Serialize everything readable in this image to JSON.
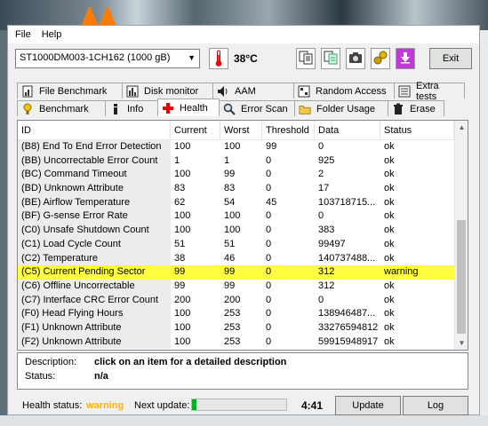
{
  "menu": [
    "File",
    "Help"
  ],
  "toolbar": {
    "drive": "ST1000DM003-1CH162 (1000 gB)",
    "temperature": "38°C",
    "exit_label": "Exit",
    "icons": [
      "copy-text-icon",
      "copy-info-icon",
      "screenshot-icon",
      "options-icon",
      "minimize-icon"
    ]
  },
  "tabs_row1": [
    {
      "label": "File Benchmark",
      "icon": "file-benchmark-icon"
    },
    {
      "label": "Disk monitor",
      "icon": "disk-monitor-icon"
    },
    {
      "label": "AAM",
      "icon": "speaker-icon"
    },
    {
      "label": "Random Access",
      "icon": "random-access-icon"
    },
    {
      "label": "Extra tests",
      "icon": "extra-tests-icon"
    }
  ],
  "tabs_row2": [
    {
      "label": "Benchmark",
      "icon": "benchmark-icon"
    },
    {
      "label": "Info",
      "icon": "info-icon"
    },
    {
      "label": "Health",
      "icon": "health-cross-icon",
      "active": true
    },
    {
      "label": "Error Scan",
      "icon": "magnifier-icon"
    },
    {
      "label": "Folder Usage",
      "icon": "folder-icon"
    },
    {
      "label": "Erase",
      "icon": "trash-icon"
    }
  ],
  "table": {
    "headers": [
      "ID",
      "Current",
      "Worst",
      "Threshold",
      "Data",
      "Status"
    ],
    "rows": [
      {
        "id": "(B8) End To End Error Detection",
        "current": "100",
        "worst": "100",
        "threshold": "99",
        "data": "0",
        "status": "ok"
      },
      {
        "id": "(BB) Uncorrectable Error Count",
        "current": "1",
        "worst": "1",
        "threshold": "0",
        "data": "925",
        "status": "ok"
      },
      {
        "id": "(BC) Command Timeout",
        "current": "100",
        "worst": "99",
        "threshold": "0",
        "data": "2",
        "status": "ok"
      },
      {
        "id": "(BD) Unknown Attribute",
        "current": "83",
        "worst": "83",
        "threshold": "0",
        "data": "17",
        "status": "ok"
      },
      {
        "id": "(BE) Airflow Temperature",
        "current": "62",
        "worst": "54",
        "threshold": "45",
        "data": "103718715...",
        "status": "ok"
      },
      {
        "id": "(BF) G-sense Error Rate",
        "current": "100",
        "worst": "100",
        "threshold": "0",
        "data": "0",
        "status": "ok"
      },
      {
        "id": "(C0) Unsafe Shutdown Count",
        "current": "100",
        "worst": "100",
        "threshold": "0",
        "data": "383",
        "status": "ok"
      },
      {
        "id": "(C1) Load Cycle Count",
        "current": "51",
        "worst": "51",
        "threshold": "0",
        "data": "99497",
        "status": "ok"
      },
      {
        "id": "(C2) Temperature",
        "current": "38",
        "worst": "46",
        "threshold": "0",
        "data": "140737488...",
        "status": "ok"
      },
      {
        "id": "(C5) Current Pending Sector",
        "current": "99",
        "worst": "99",
        "threshold": "0",
        "data": "312",
        "status": "warning",
        "highlight": true
      },
      {
        "id": "(C6) Offline Uncorrectable",
        "current": "99",
        "worst": "99",
        "threshold": "0",
        "data": "312",
        "status": "ok"
      },
      {
        "id": "(C7) Interface CRC Error Count",
        "current": "200",
        "worst": "200",
        "threshold": "0",
        "data": "0",
        "status": "ok"
      },
      {
        "id": "(F0) Head Flying Hours",
        "current": "100",
        "worst": "253",
        "threshold": "0",
        "data": "138946487...",
        "status": "ok"
      },
      {
        "id": "(F1) Unknown Attribute",
        "current": "100",
        "worst": "253",
        "threshold": "0",
        "data": "33276594812",
        "status": "ok"
      },
      {
        "id": "(F2) Unknown Attribute",
        "current": "100",
        "worst": "253",
        "threshold": "0",
        "data": "59915948917",
        "status": "ok"
      }
    ]
  },
  "description": {
    "desc_label": "Description:",
    "desc_value": "click on an item for a detailed description",
    "status_label": "Status:",
    "status_value": "n/a"
  },
  "statusbar": {
    "health_label": "Health status:",
    "health_value": "warning",
    "next_update_label": "Next update:",
    "progress_fraction": 0.05,
    "timer": "4:41",
    "update_label": "Update",
    "log_label": "Log"
  },
  "colors": {
    "warning_row": "#ffff40",
    "health_warning_text": "#ffb300",
    "progress_fill": "#06b025"
  }
}
